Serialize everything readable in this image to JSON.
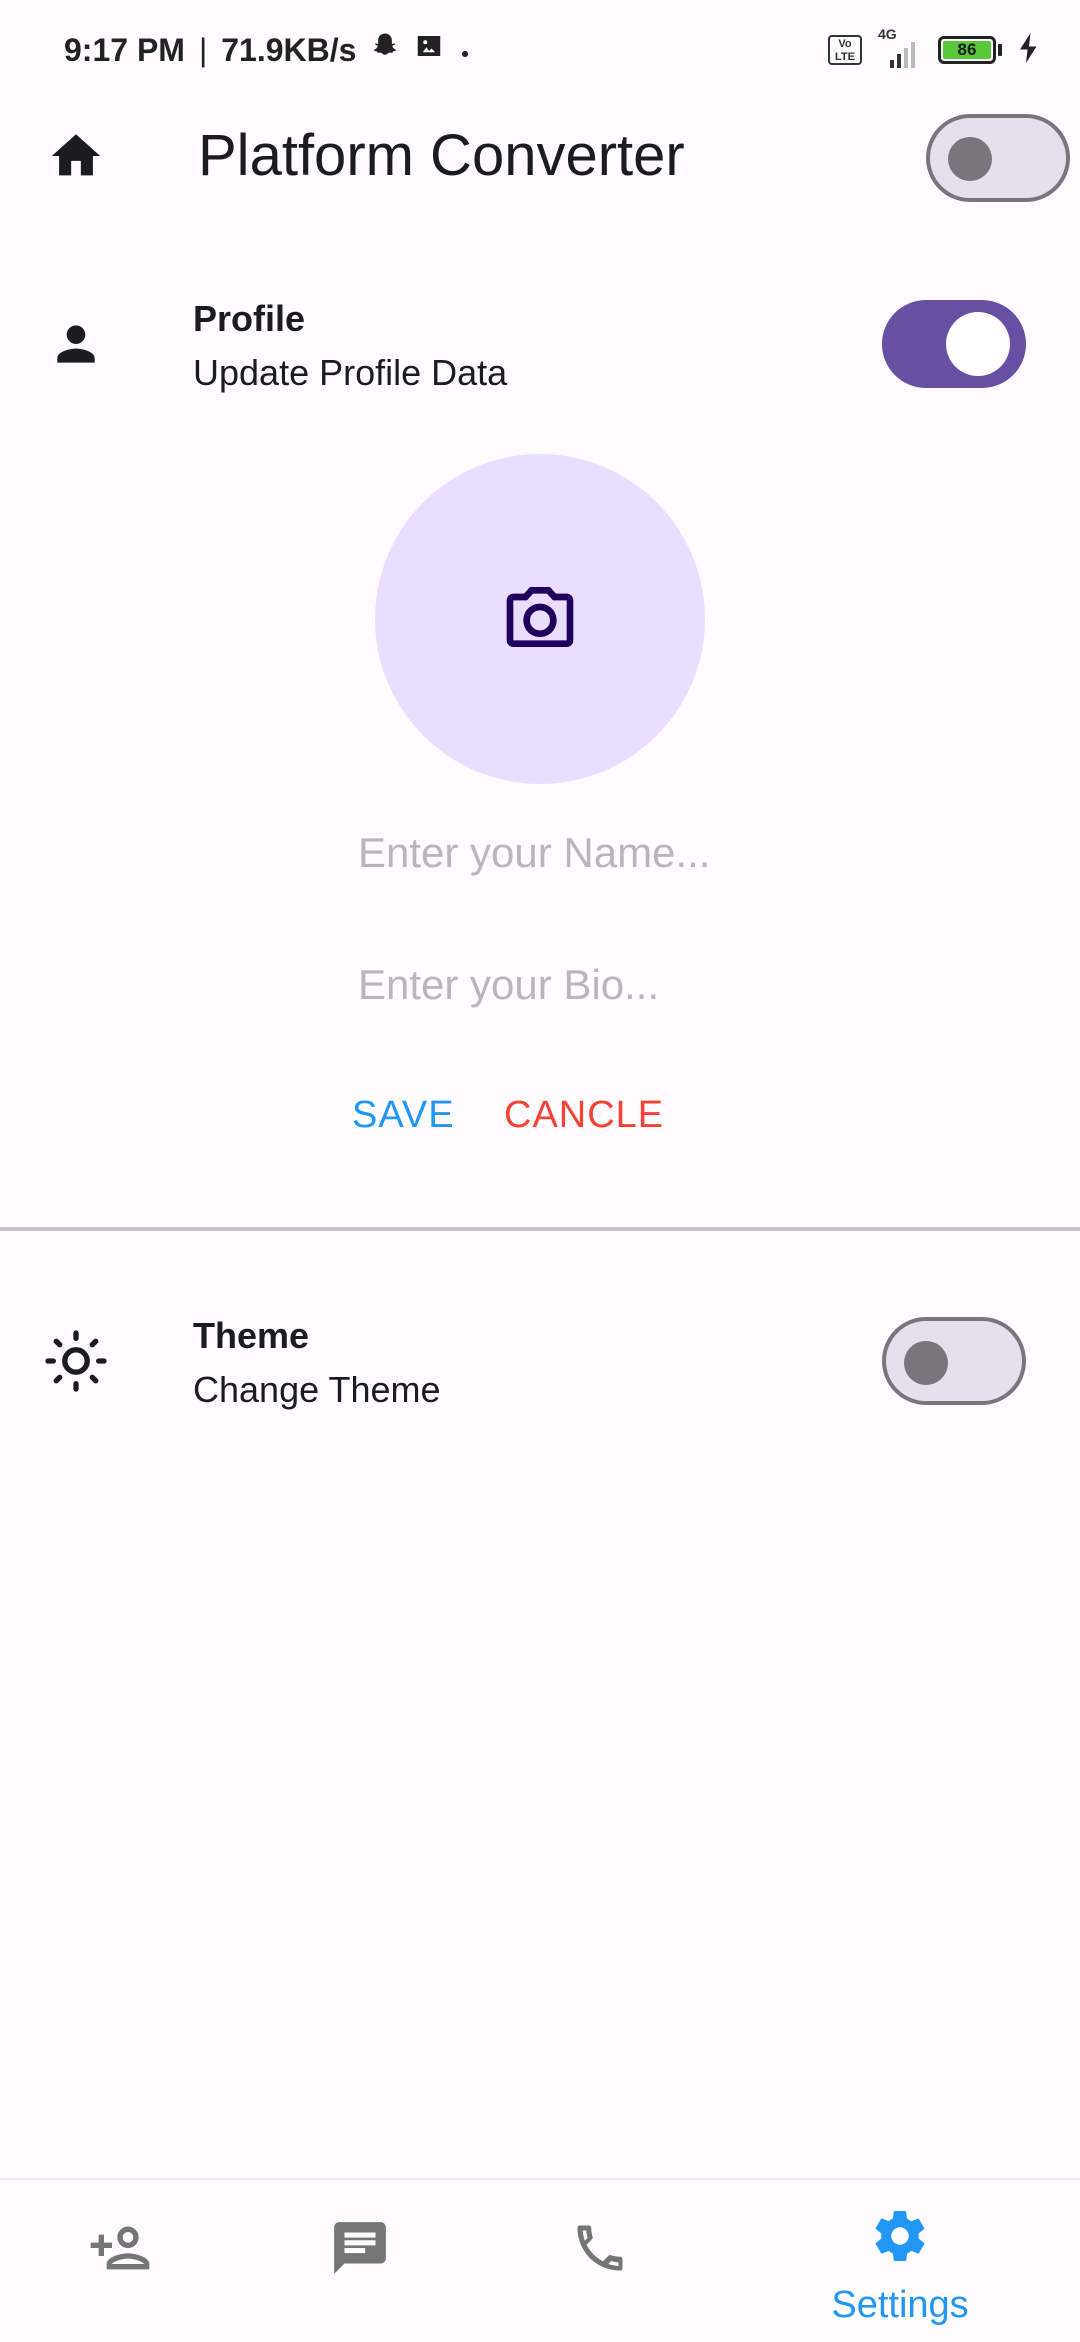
{
  "status_bar": {
    "time": "9:17 PM",
    "separator": "|",
    "network_speed": "71.9KB/s",
    "volte_label": "Vo LTE",
    "network_type": "4G",
    "battery_level": "86",
    "icons": [
      "snapchat-icon",
      "gallery-icon",
      "dot-icon",
      "volte-icon",
      "signal-icon",
      "battery-icon",
      "charging-icon"
    ]
  },
  "app_bar": {
    "title": "Platform Converter",
    "leading_icon": "home-icon",
    "platform_toggle": {
      "on": false
    }
  },
  "profile": {
    "title": "Profile",
    "subtitle": "Update Profile Data",
    "icon": "person-icon",
    "toggle": {
      "on": true
    },
    "avatar_icon": "camera-icon",
    "name_placeholder": "Enter your Name...",
    "bio_placeholder": "Enter your Bio...",
    "save_label": "SAVE",
    "cancel_label": "CANCLE"
  },
  "theme": {
    "title": "Theme",
    "subtitle": "Change Theme",
    "icon": "brightness-icon",
    "toggle": {
      "on": false
    }
  },
  "bottom_nav": {
    "items": [
      {
        "icon": "person-add-icon",
        "label": ""
      },
      {
        "icon": "chat-icon",
        "label": ""
      },
      {
        "icon": "phone-icon",
        "label": ""
      },
      {
        "icon": "settings-icon",
        "label": "Settings",
        "active": true
      }
    ]
  },
  "colors": {
    "background": "#fefbfe",
    "primary": "#6750a4",
    "avatar_bg": "#eaddff",
    "save": "#2196f3",
    "cancel": "#f44336",
    "nav_active": "#2196f3",
    "nav_inactive": "#757575"
  }
}
